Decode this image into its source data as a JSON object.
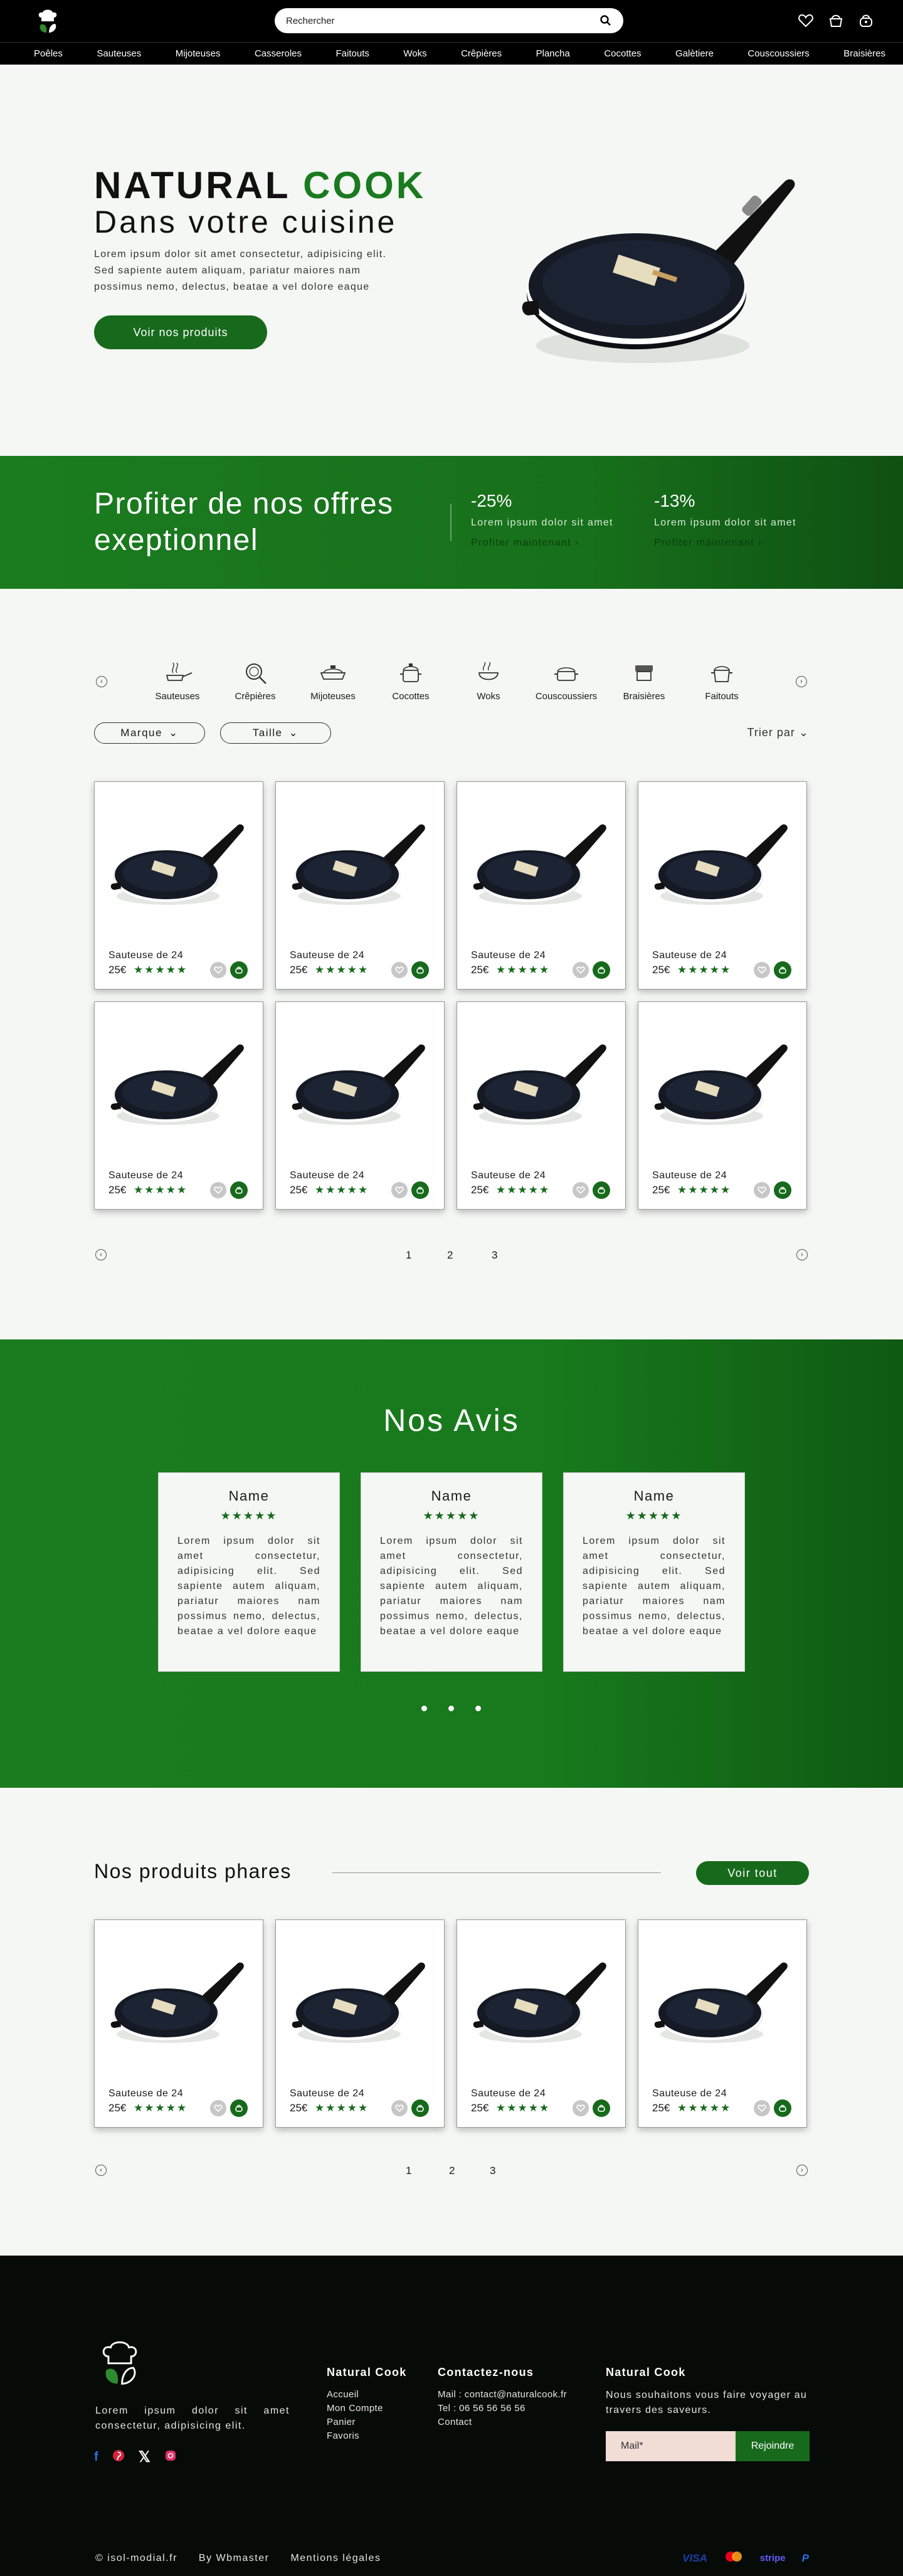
{
  "header": {
    "search_placeholder": "Rechercher",
    "icons": [
      "heart-icon",
      "pot-icon",
      "cart-icon"
    ]
  },
  "nav": [
    "Poêles",
    "Sauteuses",
    "Mijoteuses",
    "Casseroles",
    "Faitouts",
    "Woks",
    "Crêpières",
    "Plancha",
    "Cocottes",
    "Galètiere",
    "Couscoussiers",
    "Braisières"
  ],
  "hero": {
    "title_a": "NATURAL",
    "title_b": "COOK",
    "subtitle": "Dans votre cuisine",
    "text": "Lorem ipsum dolor sit amet consectetur, adipisicing elit. Sed sapiente autem aliquam, pariatur maiores nam possimus nemo, delectus, beatae a vel dolore eaque",
    "button": "Voir nos produits"
  },
  "offers": {
    "title_line1": "Profiter de nos offres",
    "title_line2": "exeptionnel",
    "items": [
      {
        "pct": "-25%",
        "text": "Lorem ipsum dolor sit amet",
        "link": "Profiter maintenant  ›"
      },
      {
        "pct": "-13%",
        "text": "Lorem ipsum dolor sit amet",
        "link": "Profiter maintenant  ›"
      }
    ]
  },
  "categories": [
    "Sauteuses",
    "Crêpières",
    "Mijoteuses",
    "Cocottes",
    "Woks",
    "Couscoussiers",
    "Braisières",
    "Faitouts"
  ],
  "filters": {
    "brand": "Marque",
    "size": "Taille",
    "sort": "Trier par"
  },
  "product": {
    "name": "Sauteuse de 24",
    "price": "25€",
    "stars": "★★★★★"
  },
  "pager": {
    "p1": "1",
    "p2": "2",
    "p3": "3"
  },
  "reviews": {
    "title": "Nos Avis",
    "items": [
      {
        "name": "Name",
        "stars": "★★★★★",
        "text": "Lorem ipsum dolor sit amet consectetur, adipisicing elit. Sed sapiente autem aliquam, pariatur maiores nam possimus nemo, delectus, beatae a vel dolore eaque"
      },
      {
        "name": "Name",
        "stars": "★★★★★",
        "text": "Lorem ipsum dolor sit amet consectetur, adipisicing elit. Sed sapiente autem aliquam, pariatur maiores nam possimus nemo, delectus, beatae a vel dolore eaque"
      },
      {
        "name": "Name",
        "stars": "★★★★★",
        "text": "Lorem ipsum dolor sit amet consectetur, adipisicing elit. Sed sapiente autem aliquam, pariatur maiores nam possimus nemo, delectus, beatae a vel dolore eaque"
      }
    ]
  },
  "featured": {
    "title": "Nos produits phares",
    "button": "Voir tout"
  },
  "footer": {
    "desc": "Lorem ipsum dolor sit amet consectetur, adipisicing elit.",
    "col1_title": "Natural Cook",
    "col1_links": [
      "Accueil",
      "Mon Compte",
      "Panier",
      "Favoris"
    ],
    "col2_title": "Contactez-nous",
    "col2_lines": [
      "Mail : contact@naturalcook.fr",
      "Tel : 06 56 56 56 56",
      "Contact"
    ],
    "news_title": "Natural Cook",
    "news_text": "Nous souhaitons vous faire voyager au travers des saveurs.",
    "mail_placeholder": "Mail*",
    "join": "Rejoindre",
    "bottom": [
      "© isol-modial.fr",
      "By Wbmaster",
      "Mentions légales"
    ],
    "payments": [
      "VISA",
      "mastercard",
      "stripe",
      "paypal"
    ]
  },
  "colors": {
    "accent": "#176a1c",
    "dark": "#060b07",
    "bg": "#f4f7f3"
  }
}
